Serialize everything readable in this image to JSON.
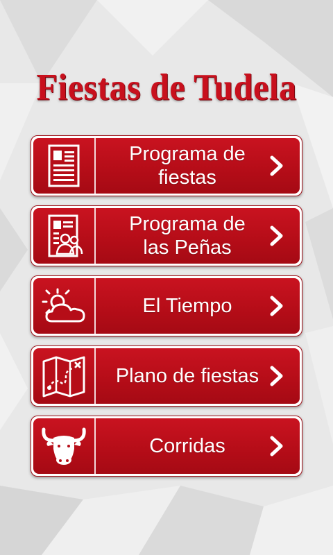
{
  "app": {
    "title": "Fiestas de Tudela"
  },
  "colors": {
    "accent": "#c8101d",
    "button_fill": "#b60d18",
    "button_border": "#ffffff",
    "background": "#e9e9e9"
  },
  "menu": {
    "items": [
      {
        "label_line1": "Programa de",
        "label_line2": "fiestas",
        "icon": "document-icon"
      },
      {
        "label_line1": "Programa de",
        "label_line2": "las Peñas",
        "icon": "people-document-icon"
      },
      {
        "label_line1": "El Tiempo",
        "label_line2": "",
        "icon": "sun-cloud-icon"
      },
      {
        "label_line1": "Plano de fiestas",
        "label_line2": "",
        "icon": "map-icon"
      },
      {
        "label_line1": "Corridas",
        "label_line2": "",
        "icon": "bull-icon"
      }
    ],
    "chevron_icon": "chevron-right-icon"
  }
}
